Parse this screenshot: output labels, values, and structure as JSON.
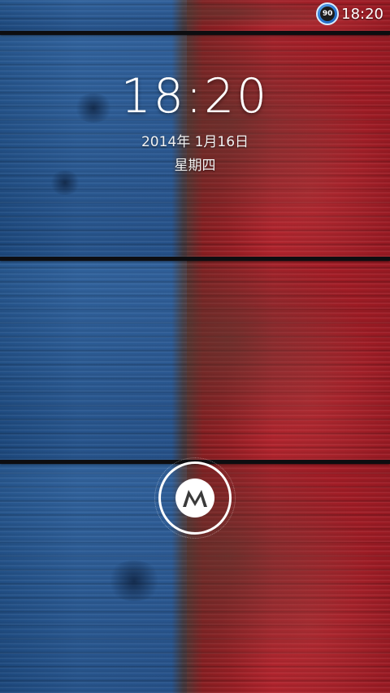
{
  "status_bar": {
    "battery_level": "90",
    "time": "18:20"
  },
  "lockscreen": {
    "time": "18:20",
    "date": "2014年 1月16日",
    "weekday": "星期四"
  },
  "unlock": {
    "icon": "motorola-logo-icon"
  },
  "colors": {
    "wallpaper_left": "#2b5d98",
    "wallpaper_right": "#b0202a",
    "battery_badge": "#2a78d2"
  }
}
